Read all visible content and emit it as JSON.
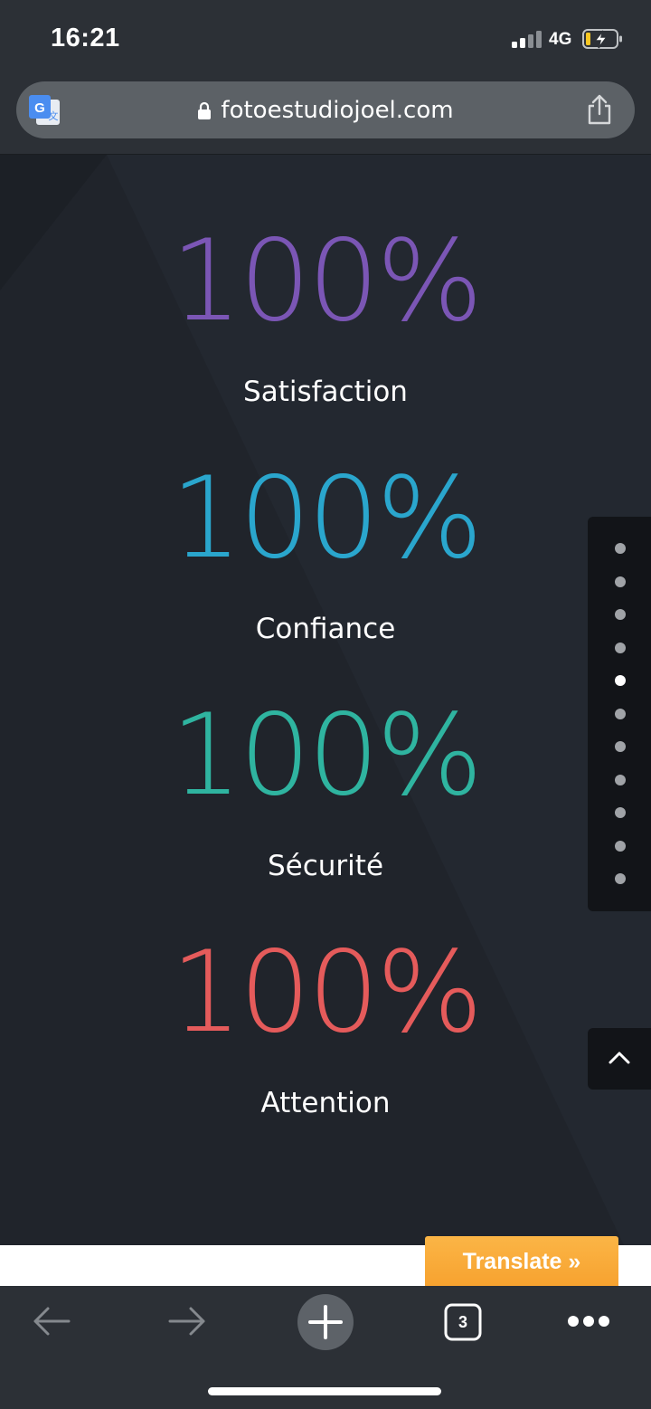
{
  "status_bar": {
    "time": "16:21",
    "network": "4G",
    "icons": [
      "signal-icon",
      "battery-charging-icon"
    ]
  },
  "browser": {
    "url": "fotoestudiojoel.com",
    "icons": [
      "google-translate-icon",
      "lock-icon",
      "share-icon"
    ]
  },
  "stats": [
    {
      "value": "100%",
      "label": "Satisfaction",
      "color": "#7b56b5"
    },
    {
      "value": "100%",
      "label": "Confiance",
      "color": "#2aa6cd"
    },
    {
      "value": "100%",
      "label": "Sécurité",
      "color": "#2fb4a0"
    },
    {
      "value": "100%",
      "label": "Attention",
      "color": "#e55b5b"
    }
  ],
  "section_nav": {
    "dot_count": 11,
    "active_index": 4
  },
  "scroll_top": {
    "icon": "chevron-up-icon"
  },
  "translate_button": {
    "label": "Translate »",
    "color": "#f7a22f"
  },
  "bottom_toolbar": {
    "tab_count": "3",
    "icons": [
      "back-arrow-icon",
      "forward-arrow-icon",
      "new-tab-plus-icon",
      "tabs-icon",
      "more-icon"
    ]
  }
}
